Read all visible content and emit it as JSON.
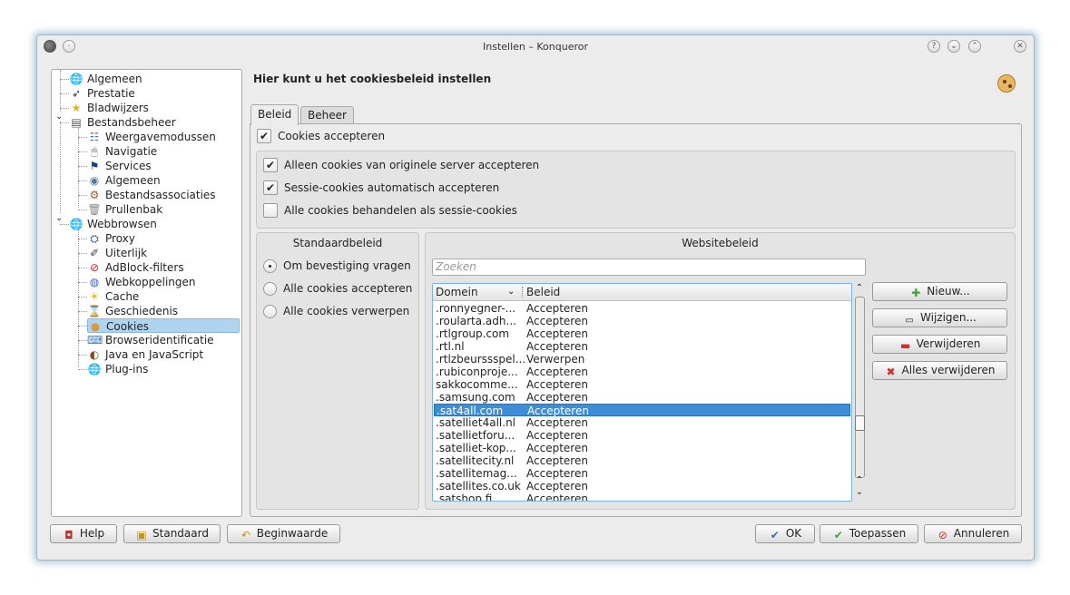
{
  "window": {
    "title": "Instellen – Konqueror"
  },
  "tree": {
    "items": [
      {
        "label": "Algemeen",
        "icon": "globe-icon",
        "glyph": "🌐"
      },
      {
        "label": "Prestatie",
        "icon": "rocket-icon",
        "glyph": "➶"
      },
      {
        "label": "Bladwijzers",
        "icon": "star-icon",
        "glyph": "★"
      },
      {
        "label": "Bestandsbeheer",
        "icon": "file-manager-icon",
        "glyph": "▤"
      },
      {
        "label": "Weergavemodussen",
        "icon": "view-modes-icon",
        "glyph": "☷"
      },
      {
        "label": "Navigatie",
        "icon": "mouse-icon",
        "glyph": "🖱"
      },
      {
        "label": "Services",
        "icon": "flag-icon",
        "glyph": "⚑"
      },
      {
        "label": "Algemeen",
        "icon": "settings-icon",
        "glyph": "◉"
      },
      {
        "label": "Bestandsassociaties",
        "icon": "file-association-icon",
        "glyph": "⚙"
      },
      {
        "label": "Prullenbak",
        "icon": "trash-icon",
        "glyph": "🗑"
      },
      {
        "label": "Webbrowsen",
        "icon": "globe-icon",
        "glyph": "🌐"
      },
      {
        "label": "Proxy",
        "icon": "proxy-icon",
        "glyph": "⛭"
      },
      {
        "label": "Uiterlijk",
        "icon": "appearance-icon",
        "glyph": "✐"
      },
      {
        "label": "AdBlock-filters",
        "icon": "adblock-icon",
        "glyph": "⊘"
      },
      {
        "label": "Webkoppelingen",
        "icon": "web-links-icon",
        "glyph": "◍"
      },
      {
        "label": "Cache",
        "icon": "cache-icon",
        "glyph": "☀"
      },
      {
        "label": "Geschiedenis",
        "icon": "hourglass-icon",
        "glyph": "⌛"
      },
      {
        "label": "Cookies",
        "icon": "cookie-icon",
        "glyph": "●"
      },
      {
        "label": "Browseridentificatie",
        "icon": "browser-id-icon",
        "glyph": "⌨"
      },
      {
        "label": "Java en JavaScript",
        "icon": "java-icon",
        "glyph": "◐"
      },
      {
        "label": "Plug-ins",
        "icon": "plugin-icon",
        "glyph": "🌐"
      }
    ]
  },
  "page": {
    "heading": "Hier kunt u het cookiesbeleid instellen",
    "tabs": [
      "Beleid",
      "Beheer"
    ]
  },
  "policy": {
    "accept_cookies": {
      "label": "Cookies accepteren",
      "checked": true
    },
    "origin_only": {
      "label": "Alleen cookies van originele server accepteren",
      "checked": true
    },
    "session_auto": {
      "label": "Sessie-cookies automatisch accepteren",
      "checked": true
    },
    "treat_as_session": {
      "label": "Alle cookies behandelen als sessie-cookies",
      "checked": false
    }
  },
  "default_policy": {
    "title": "Standaardbeleid",
    "options": [
      {
        "label": "Om bevestiging vragen",
        "selected": true
      },
      {
        "label": "Alle cookies accepteren",
        "selected": false
      },
      {
        "label": "Alle cookies verwerpen",
        "selected": false
      }
    ]
  },
  "website_policy": {
    "title": "Websitebeleid",
    "search_placeholder": "Zoeken",
    "columns": [
      "Domein",
      "Beleid"
    ],
    "rows": [
      {
        "domain": ".ronnyegner-...",
        "policy": "Accepteren"
      },
      {
        "domain": ".roularta.adh...",
        "policy": "Accepteren"
      },
      {
        "domain": ".rtlgroup.com",
        "policy": "Accepteren"
      },
      {
        "domain": ".rtl.nl",
        "policy": "Accepteren"
      },
      {
        "domain": ".rtlzbeurssspel...",
        "policy": "Verwerpen"
      },
      {
        "domain": ".rubiconproje...",
        "policy": "Accepteren"
      },
      {
        "domain": "sakkocomme...",
        "policy": "Accepteren"
      },
      {
        "domain": ".samsung.com",
        "policy": "Accepteren"
      },
      {
        "domain": ".sat4all.com",
        "policy": "Accepteren",
        "selected": true
      },
      {
        "domain": ".satelliet4all.nl",
        "policy": "Accepteren"
      },
      {
        "domain": ".satellietforu...",
        "policy": "Accepteren"
      },
      {
        "domain": ".satelliet-kop...",
        "policy": "Accepteren"
      },
      {
        "domain": ".satellitecity.nl",
        "policy": "Accepteren"
      },
      {
        "domain": ".satellitemag...",
        "policy": "Accepteren"
      },
      {
        "domain": ".satellites.co.uk",
        "policy": "Accepteren"
      },
      {
        "domain": ".satshop.fi",
        "policy": "Accepteren"
      }
    ],
    "buttons": {
      "new": "Nieuw...",
      "change": "Wijzigen...",
      "delete": "Verwijderen",
      "delete_all": "Alles verwijderen"
    }
  },
  "footer": {
    "help": "Help",
    "defaults": "Standaard",
    "reset": "Beginwaarde",
    "ok": "OK",
    "apply": "Toepassen",
    "cancel": "Annuleren"
  },
  "colors": {
    "selection": "#3d8ed6",
    "tree_selection": "#b0d4f0",
    "window_glow": "#6ea0be"
  }
}
